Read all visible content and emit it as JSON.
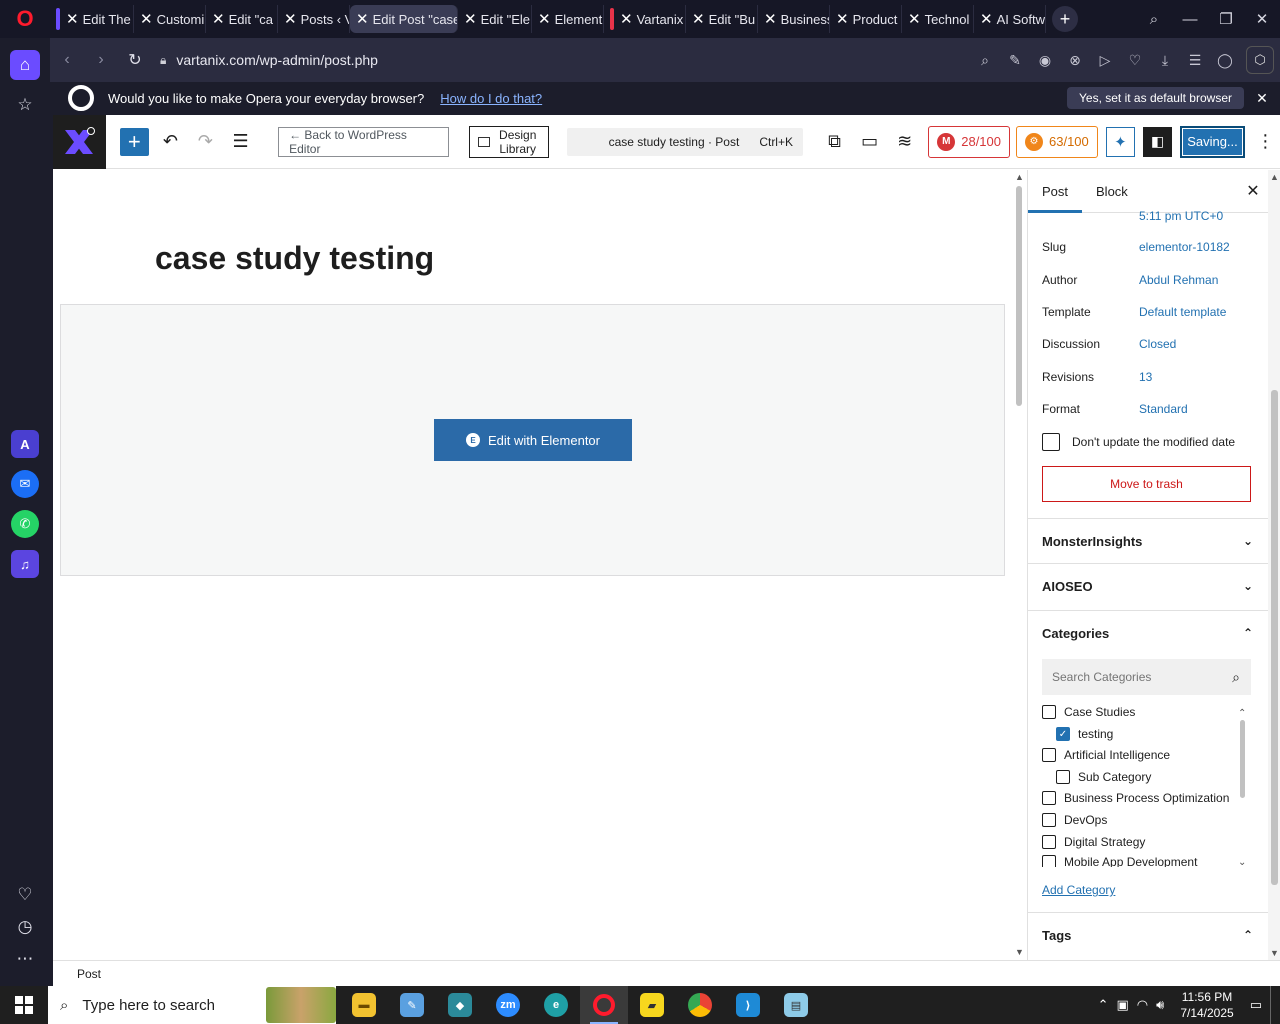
{
  "browser": {
    "tabs": [
      {
        "title": "Edit The",
        "active": false
      },
      {
        "title": "Customi",
        "active": false
      },
      {
        "title": "Edit \"ca",
        "active": false
      },
      {
        "title": "Posts ‹ V",
        "active": false
      },
      {
        "title": "Edit Post \"case",
        "active": true
      },
      {
        "title": "Edit \"Ele",
        "active": false
      },
      {
        "title": "Element",
        "active": false
      },
      {
        "title": "Vartanix",
        "active": false
      },
      {
        "title": "Edit \"Bu",
        "active": false
      },
      {
        "title": "Business",
        "active": false
      },
      {
        "title": "Product",
        "active": false
      },
      {
        "title": "Technol",
        "active": false
      },
      {
        "title": "AI Softw",
        "active": false
      }
    ],
    "url": "vartanix.com/wp-admin/post.php",
    "infobar": {
      "text": "Would you like to make Opera your everyday browser?",
      "link": "How do I do that?",
      "button": "Yes, set it as default browser"
    }
  },
  "editor": {
    "back_button": "← Back to WordPress Editor",
    "design_library": "Design Library",
    "command_title": "case study testing · Post",
    "command_shortcut": "Ctrl+K",
    "score_red": "28/100",
    "score_orange": "63/100",
    "save_status": "Saving...",
    "post_title": "case study testing",
    "elementor_button": "Edit with Elementor",
    "footer_breadcrumb": "Post"
  },
  "settings": {
    "tabs": [
      "Post",
      "Block"
    ],
    "time_partial": "5:11 pm UTC+0",
    "rows": [
      {
        "label": "Slug",
        "value": "elementor-10182"
      },
      {
        "label": "Author",
        "value": "Abdul Rehman"
      },
      {
        "label": "Template",
        "value": "Default template"
      },
      {
        "label": "Discussion",
        "value": "Closed"
      },
      {
        "label": "Revisions",
        "value": "13"
      },
      {
        "label": "Format",
        "value": "Standard"
      }
    ],
    "dont_update": "Don't update the modified date",
    "trash": "Move to trash",
    "panels": {
      "monsterinsights": "MonsterInsights",
      "aioseo": "AIOSEO",
      "categories": "Categories",
      "tags": "Tags"
    },
    "search_placeholder": "Search Categories",
    "categories": [
      {
        "name": "Case Studies",
        "checked": false,
        "child": false
      },
      {
        "name": "testing",
        "checked": true,
        "child": true
      },
      {
        "name": "Artificial Intelligence",
        "checked": false,
        "child": false
      },
      {
        "name": "Sub Category",
        "checked": false,
        "child": true
      },
      {
        "name": "Business Process Optimization",
        "checked": false,
        "child": false
      },
      {
        "name": "DevOps",
        "checked": false,
        "child": false
      },
      {
        "name": "Digital Strategy",
        "checked": false,
        "child": false
      },
      {
        "name": "Mobile App Development",
        "checked": false,
        "child": false
      }
    ],
    "add_category": "Add Category"
  },
  "taskbar": {
    "search_placeholder": "Type here to search",
    "time": "11:56 PM",
    "date": "7/14/2025"
  },
  "colors": {
    "wp_blue": "#2271b1",
    "elementor_button": "#2b6aa8",
    "trash_red": "#cc1818",
    "opera_red": "#ff1b2d"
  }
}
